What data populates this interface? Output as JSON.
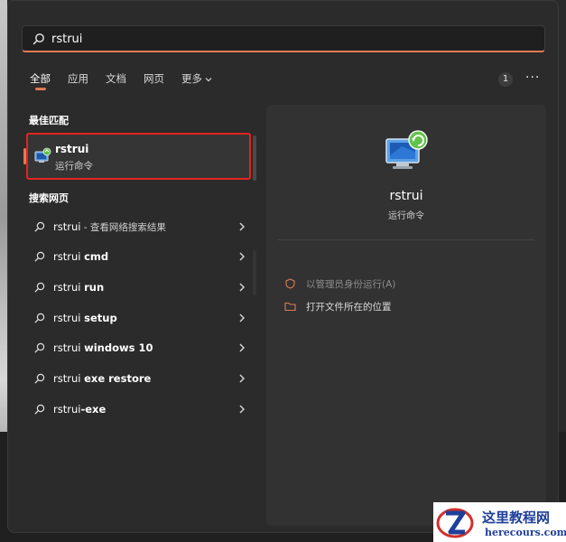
{
  "search": {
    "value": "rstrui",
    "placeholder": ""
  },
  "tabs": [
    {
      "label": "全部",
      "active": true
    },
    {
      "label": "应用"
    },
    {
      "label": "文档"
    },
    {
      "label": "网页"
    },
    {
      "label": "更多"
    }
  ],
  "header_badge": "1",
  "more_options": "···",
  "sections": {
    "best_match": "最佳匹配",
    "web_search": "搜索网页"
  },
  "best_match": {
    "title": "rstrui",
    "subtitle": "运行命令"
  },
  "web_results": [
    {
      "prefix": "rstrui",
      "bold": "",
      "suffix": " - 查看网络搜索结果"
    },
    {
      "prefix": "rstrui ",
      "bold": "cmd",
      "suffix": ""
    },
    {
      "prefix": "rstrui ",
      "bold": "run",
      "suffix": ""
    },
    {
      "prefix": "rstrui ",
      "bold": "setup",
      "suffix": ""
    },
    {
      "prefix": "rstrui ",
      "bold": "windows 10",
      "suffix": ""
    },
    {
      "prefix": "rstrui ",
      "bold": "exe restore",
      "suffix": ""
    },
    {
      "prefix": "rstrui",
      "bold": "-exe",
      "suffix": ""
    }
  ],
  "detail": {
    "title": "rstrui",
    "subtitle": "运行命令",
    "actions": [
      {
        "label": "以管理员身份运行(A)",
        "faded": true
      },
      {
        "label": "打开文件所在的位置",
        "faded": false
      }
    ]
  },
  "watermark": {
    "title": "这里教程网",
    "url": "herecours.com"
  },
  "colors": {
    "accent": "#e07a54",
    "highlight_border": "#e5231f",
    "panel_bg": "#2b2b2b",
    "detail_bg": "#323232"
  }
}
